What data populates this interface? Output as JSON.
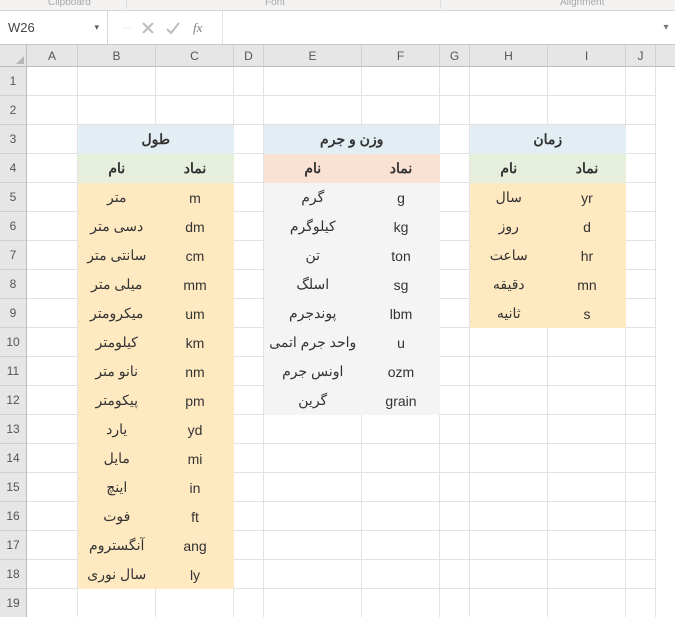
{
  "ribbon": {
    "group1": "Clipboard",
    "group2": "Font",
    "group3": "Alignment"
  },
  "namebox": {
    "value": "W26",
    "fx": "fx",
    "down": "▾"
  },
  "formula": {
    "value": ""
  },
  "col_widths": {
    "A": 51,
    "B": 78,
    "C": 78,
    "D": 30,
    "E": 98,
    "F": 78,
    "G": 30,
    "H": 78,
    "I": 78,
    "J": 30
  },
  "cols": [
    "A",
    "B",
    "C",
    "D",
    "E",
    "F",
    "G",
    "H",
    "I",
    "J"
  ],
  "rows": [
    "1",
    "2",
    "3",
    "4",
    "5",
    "6",
    "7",
    "8",
    "9",
    "10",
    "11",
    "12",
    "13",
    "14",
    "15",
    "16",
    "17",
    "18",
    "19"
  ],
  "tables": {
    "length": {
      "title": "طول",
      "headers": {
        "name": "نام",
        "symbol": "نماد"
      },
      "data": [
        {
          "name": "متر",
          "symbol": "m"
        },
        {
          "name": "دسی متر",
          "symbol": "dm"
        },
        {
          "name": "سانتی متر",
          "symbol": "cm"
        },
        {
          "name": "میلی متر",
          "symbol": "mm"
        },
        {
          "name": "میکرومتر",
          "symbol": "um"
        },
        {
          "name": "کیلومتر",
          "symbol": "km"
        },
        {
          "name": "نانو متر",
          "symbol": "nm"
        },
        {
          "name": "پیکومتر",
          "symbol": "pm"
        },
        {
          "name": "یارد",
          "symbol": "yd"
        },
        {
          "name": "مایل",
          "symbol": "mi"
        },
        {
          "name": "اینچ",
          "symbol": "in"
        },
        {
          "name": "فوت",
          "symbol": "ft"
        },
        {
          "name": "آنگستروم",
          "symbol": "ang"
        },
        {
          "name": "سال نوری",
          "symbol": "ly"
        }
      ]
    },
    "mass": {
      "title": "وزن و جرم",
      "headers": {
        "name": "نام",
        "symbol": "نماد"
      },
      "data": [
        {
          "name": "گرم",
          "symbol": "g"
        },
        {
          "name": "کیلوگرم",
          "symbol": "kg"
        },
        {
          "name": "تن",
          "symbol": "ton"
        },
        {
          "name": "اسلگ",
          "symbol": "sg"
        },
        {
          "name": "پوندجرم",
          "symbol": "lbm"
        },
        {
          "name": "واحد جرم اتمی",
          "symbol": "u"
        },
        {
          "name": "اونس جرم",
          "symbol": "ozm"
        },
        {
          "name": "گرین",
          "symbol": "grain"
        }
      ]
    },
    "time": {
      "title": "زمان",
      "headers": {
        "name": "نام",
        "symbol": "نماد"
      },
      "data": [
        {
          "name": "سال",
          "symbol": "yr"
        },
        {
          "name": "روز",
          "symbol": "d"
        },
        {
          "name": "ساعت",
          "symbol": "hr"
        },
        {
          "name": "دقیقه",
          "symbol": "mn"
        },
        {
          "name": "ثانیه",
          "symbol": "s"
        }
      ]
    }
  }
}
